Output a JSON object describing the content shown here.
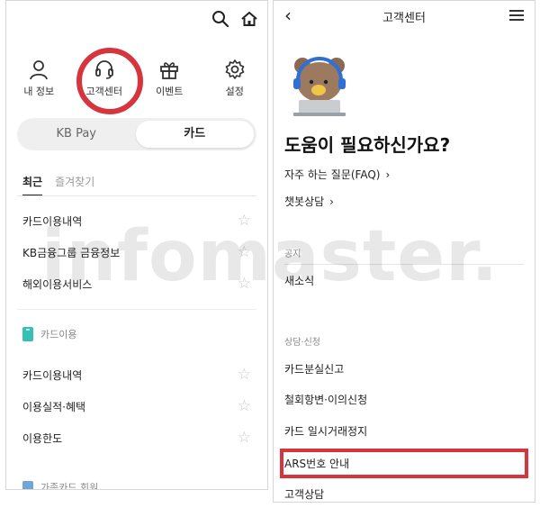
{
  "left": {
    "quick_menu": [
      {
        "label": "내 정보",
        "icon": "person-icon"
      },
      {
        "label": "고객센터",
        "icon": "headset-icon"
      },
      {
        "label": "이벤트",
        "icon": "gift-icon"
      },
      {
        "label": "설정",
        "icon": "gear-icon"
      }
    ],
    "toggle": {
      "kbpay": "KB Pay",
      "card": "카드"
    },
    "tabs": {
      "recent": "최근",
      "favorites": "즐겨찾기"
    },
    "recent_items": [
      "카드이용내역",
      "KB금융그룹 금융정보",
      "해외이용서비스"
    ],
    "card_use_section": "카드이용",
    "card_use_items": [
      "카드이용내역",
      "이용실적·혜택",
      "이용한도"
    ],
    "family_card_section": "가족카드 회원"
  },
  "right": {
    "title": "고객센터",
    "headline": "도움이 필요하신가요?",
    "faq_link": "자주 하는 질문(FAQ)",
    "chatbot_link": "챗봇상담",
    "notice_section": "공지",
    "notice_item": "새소식",
    "consult_section": "상담·신청",
    "consult_items": [
      "카드분실신고",
      "철회항변·이의신청",
      "카드 일시거래정지",
      "ARS번호 안내",
      "고객상담"
    ]
  },
  "watermark": "infomaster.",
  "colors": {
    "highlight": "#d7353d",
    "mint": "#35c0b3",
    "bear_brown": "#8a6a52",
    "headset_blue": "#2f6fd6"
  }
}
